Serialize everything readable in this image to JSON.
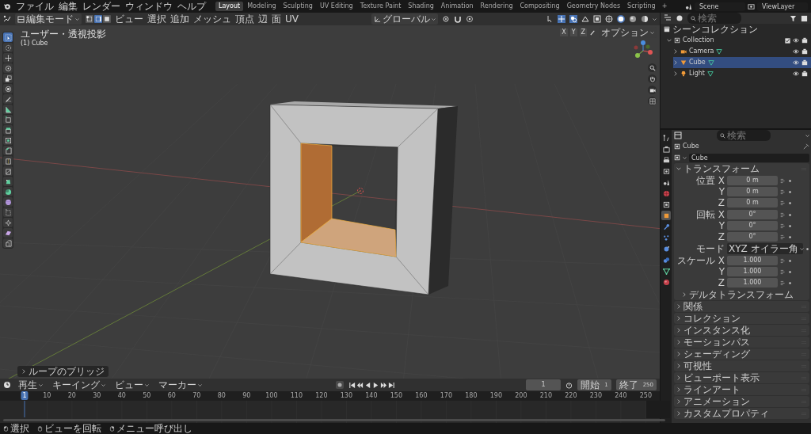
{
  "menu": [
    "ファイル",
    "編集",
    "レンダー",
    "ウィンドウ",
    "ヘルプ"
  ],
  "workspaces": [
    {
      "label": "Layout",
      "selected": true
    },
    {
      "label": "Modeling",
      "selected": false
    },
    {
      "label": "Sculpting",
      "selected": false
    },
    {
      "label": "UV Editing",
      "selected": false
    },
    {
      "label": "Texture Paint",
      "selected": false
    },
    {
      "label": "Shading",
      "selected": false
    },
    {
      "label": "Animation",
      "selected": false
    },
    {
      "label": "Rendering",
      "selected": false
    },
    {
      "label": "Compositing",
      "selected": false
    },
    {
      "label": "Geometry Nodes",
      "selected": false
    },
    {
      "label": "Scripting",
      "selected": false
    }
  ],
  "add_workspace": "+",
  "scene": "Scene",
  "view_layer": "ViewLayer",
  "viewport": {
    "mode": "編集モード",
    "select_modes": [
      {
        "kind": "vertex",
        "selected": false
      },
      {
        "kind": "edge",
        "selected": true
      },
      {
        "kind": "face",
        "selected": false
      }
    ],
    "menus": [
      "ビュー",
      "選択",
      "追加",
      "メッシュ",
      "頂点",
      "辺",
      "面",
      "UV"
    ],
    "orientation": "グローバル",
    "options": "オプション",
    "axes": [
      "X",
      "Y",
      "Z"
    ],
    "view_name": "ユーザー・透視投影",
    "object_name": "(1) Cube",
    "last_operator": "ループのブリッジ"
  },
  "tools": [
    {
      "kind": "select",
      "selected": true
    },
    {
      "kind": "cursor",
      "selected": false
    },
    {
      "kind": "move",
      "selected": false
    },
    {
      "kind": "rotate",
      "selected": false
    },
    {
      "kind": "scale",
      "selected": false
    },
    {
      "kind": "transform",
      "selected": false
    },
    {
      "kind": "annotate",
      "selected": false
    },
    {
      "kind": "measure",
      "selected": false
    },
    {
      "kind": "add-cube",
      "selected": false
    },
    {
      "kind": "extrude",
      "selected": false
    },
    {
      "kind": "inset",
      "selected": false
    },
    {
      "kind": "bevel",
      "selected": false
    },
    {
      "kind": "loopcut",
      "selected": false
    },
    {
      "kind": "knife",
      "selected": false
    },
    {
      "kind": "polybuild",
      "selected": false
    },
    {
      "kind": "spin",
      "selected": false
    },
    {
      "kind": "smooth",
      "selected": false
    },
    {
      "kind": "slide",
      "selected": false
    },
    {
      "kind": "shrink",
      "selected": false
    },
    {
      "kind": "shear",
      "selected": false
    },
    {
      "kind": "rip",
      "selected": false
    }
  ],
  "outliner": {
    "search_placeholder": "検索",
    "root_label": "シーンコレクション",
    "items": [
      {
        "label": "Collection",
        "kind": "collection",
        "expanded": true,
        "selected": false,
        "children": [
          {
            "label": "Camera",
            "kind": "camera",
            "expanded": false,
            "selected": false
          },
          {
            "label": "Cube",
            "kind": "mesh",
            "expanded": false,
            "selected": true
          },
          {
            "label": "Light",
            "kind": "light",
            "expanded": false,
            "selected": false
          }
        ]
      }
    ]
  },
  "properties": {
    "search_placeholder": "検索",
    "tabs": [
      {
        "kind": "tool",
        "selected": false
      },
      {
        "kind": "render",
        "selected": false
      },
      {
        "kind": "output",
        "selected": false
      },
      {
        "kind": "view-layer",
        "selected": false
      },
      {
        "kind": "scene",
        "selected": false
      },
      {
        "kind": "world",
        "selected": false
      },
      {
        "kind": "collection",
        "selected": false
      },
      {
        "kind": "object",
        "selected": true
      },
      {
        "kind": "modifiers",
        "selected": false
      },
      {
        "kind": "particles",
        "selected": false
      },
      {
        "kind": "physics",
        "selected": false
      },
      {
        "kind": "constraints",
        "selected": false
      },
      {
        "kind": "data",
        "selected": false
      },
      {
        "kind": "material",
        "selected": false
      }
    ],
    "breadcrumb": "Cube",
    "name": "Cube",
    "panel_title": "トランスフォーム",
    "groups": [
      {
        "fields": [
          {
            "kind": "number",
            "label": "位置 X",
            "value": "0 m"
          },
          {
            "kind": "number",
            "label": "Y",
            "value": "0 m"
          },
          {
            "kind": "number",
            "label": "Z",
            "value": "0 m"
          }
        ]
      },
      {
        "fields": [
          {
            "kind": "number",
            "label": "回転 X",
            "value": "0°"
          },
          {
            "kind": "number",
            "label": "Y",
            "value": "0°"
          },
          {
            "kind": "number",
            "label": "Z",
            "value": "0°"
          }
        ]
      },
      {
        "fields": [
          {
            "kind": "dropdown",
            "label": "モード",
            "value": "XYZ オイラー角"
          }
        ]
      },
      {
        "fields": [
          {
            "kind": "number",
            "label": "スケール X",
            "value": "1.000"
          },
          {
            "kind": "number",
            "label": "Y",
            "value": "1.000"
          },
          {
            "kind": "number",
            "label": "Z",
            "value": "1.000"
          }
        ]
      }
    ],
    "subpanel": "デルタトランスフォーム",
    "panels": [
      "関係",
      "コレクション",
      "インスタンス化",
      "モーションパス",
      "シェーディング",
      "可視性",
      "ビューポート表示",
      "ラインアート",
      "アニメーション",
      "カスタムプロパティ"
    ]
  },
  "timeline": {
    "menus": [
      "再生",
      "キーイング",
      "ビュー",
      "マーカー"
    ],
    "current_frame": "1",
    "start_label": "開始",
    "start": "1",
    "end_label": "終了",
    "end": "250",
    "playhead": "1",
    "ticks": [
      "10",
      "20",
      "30",
      "40",
      "50",
      "60",
      "70",
      "80",
      "90",
      "100",
      "110",
      "120",
      "130",
      "140",
      "150",
      "160",
      "170",
      "180",
      "190",
      "200",
      "210",
      "220",
      "230",
      "240",
      "250"
    ]
  },
  "status_bar": [
    {
      "kind": "left",
      "label": "選択"
    },
    {
      "kind": "middle",
      "label": "ビューを回転"
    },
    {
      "kind": "right",
      "label": "メニュー呼び出し"
    }
  ]
}
